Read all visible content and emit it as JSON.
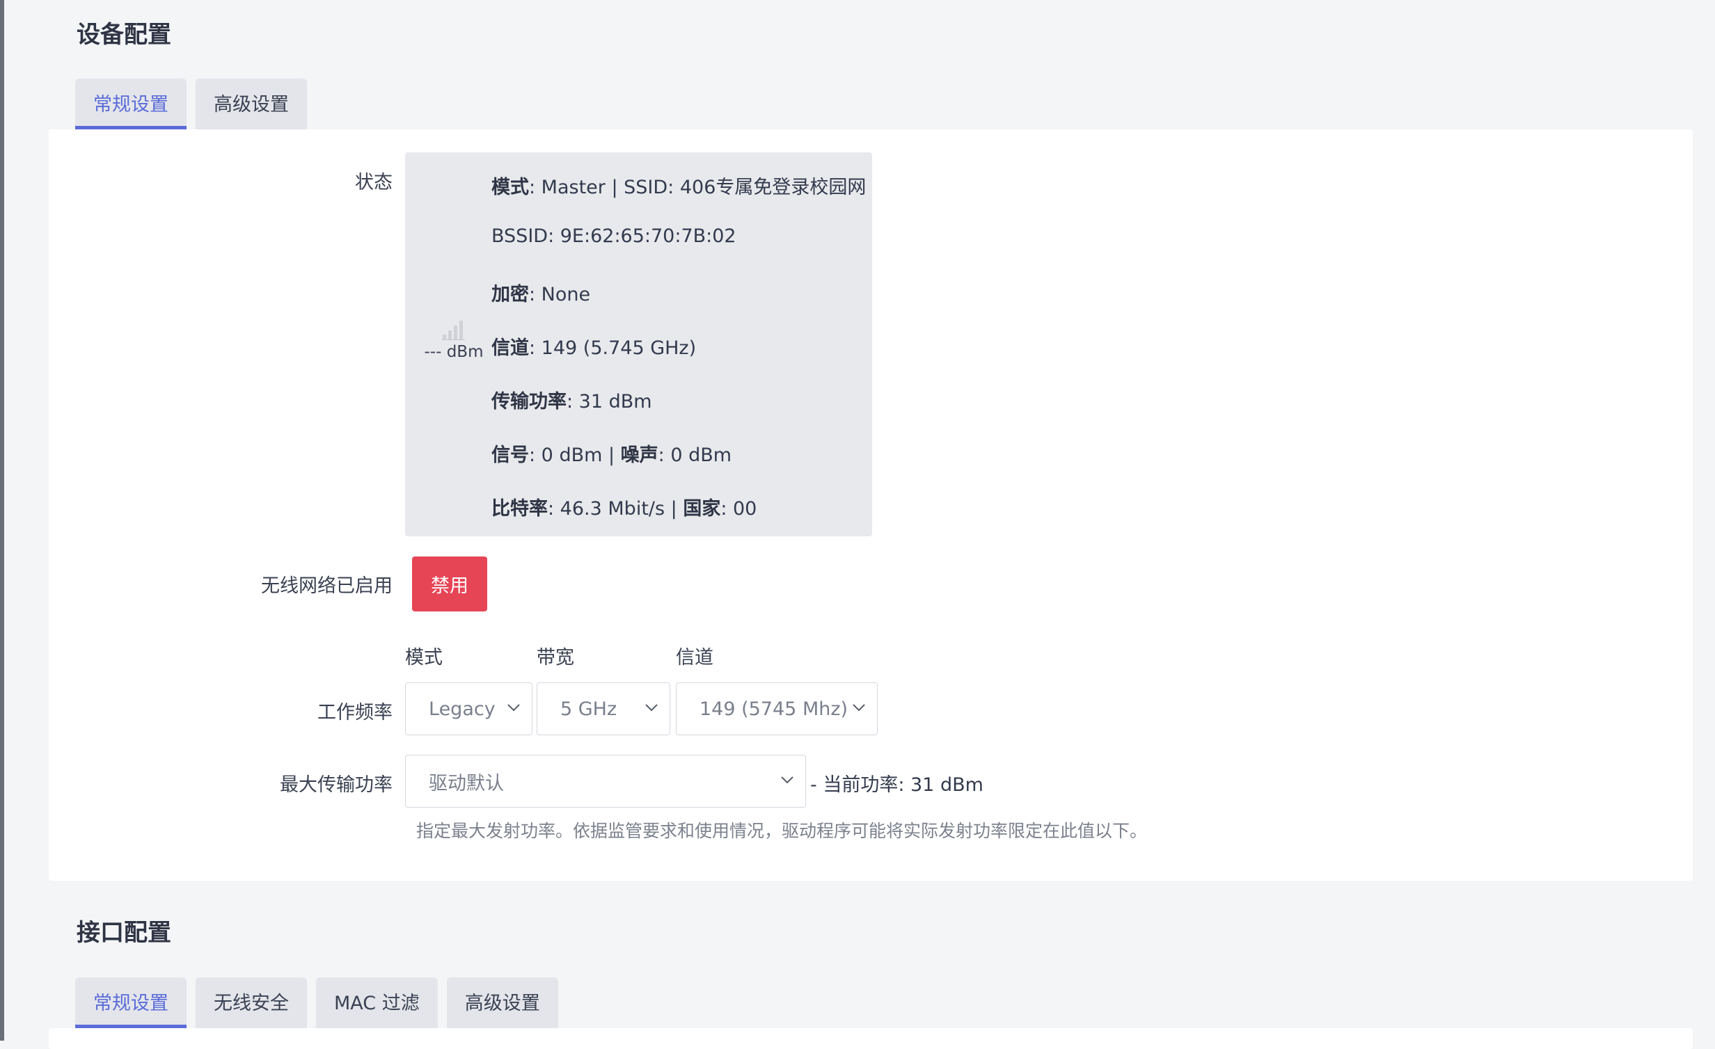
{
  "device": {
    "title": "设备配置",
    "tabs": [
      "常规设置",
      "高级设置"
    ],
    "status": {
      "label": "状态",
      "signal_text": "--- dBm",
      "lines": [
        {
          "k1": "模式",
          "v1": ": Master | SSID: 406专属免登录校园网"
        },
        {
          "k1": "",
          "v1": "BSSID: 9E:62:65:70:7B:02"
        },
        {
          "k1": "加密",
          "v1": ": None"
        },
        {
          "k1": "信道",
          "v1": ": 149 (5.745 GHz)"
        },
        {
          "k1": "传输功率",
          "v1": ": 31 dBm"
        },
        {
          "k1": "信号",
          "v1": ": 0 dBm | ",
          "k2": "噪声",
          "v2": ": 0 dBm"
        },
        {
          "k1": "比特率",
          "v1": ": 46.3 Mbit/s | ",
          "k2": "国家",
          "v2": ": 00"
        }
      ]
    },
    "wireless": {
      "label": "无线网络已启用",
      "button": "禁用",
      "button_color": "#e64556"
    },
    "frequency": {
      "label": "工作频率",
      "mode_label": "模式",
      "bandwidth_label": "带宽",
      "channel_label": "信道",
      "mode_value": "Legacy",
      "bandwidth_value": "5 GHz",
      "channel_value": "149 (5745 Mhz)"
    },
    "txpower": {
      "label": "最大传输功率",
      "value": "驱动默认",
      "current": "- 当前功率: 31 dBm",
      "hint": "指定最大发射功率。依据监管要求和使用情况，驱动程序可能将实际发射功率限定在此值以下。"
    }
  },
  "interface": {
    "title": "接口配置",
    "tabs": [
      "常规设置",
      "无线安全",
      "MAC 过滤",
      "高级设置"
    ]
  },
  "colors": {
    "accent": "#5b6bd8",
    "danger": "#e64556"
  }
}
